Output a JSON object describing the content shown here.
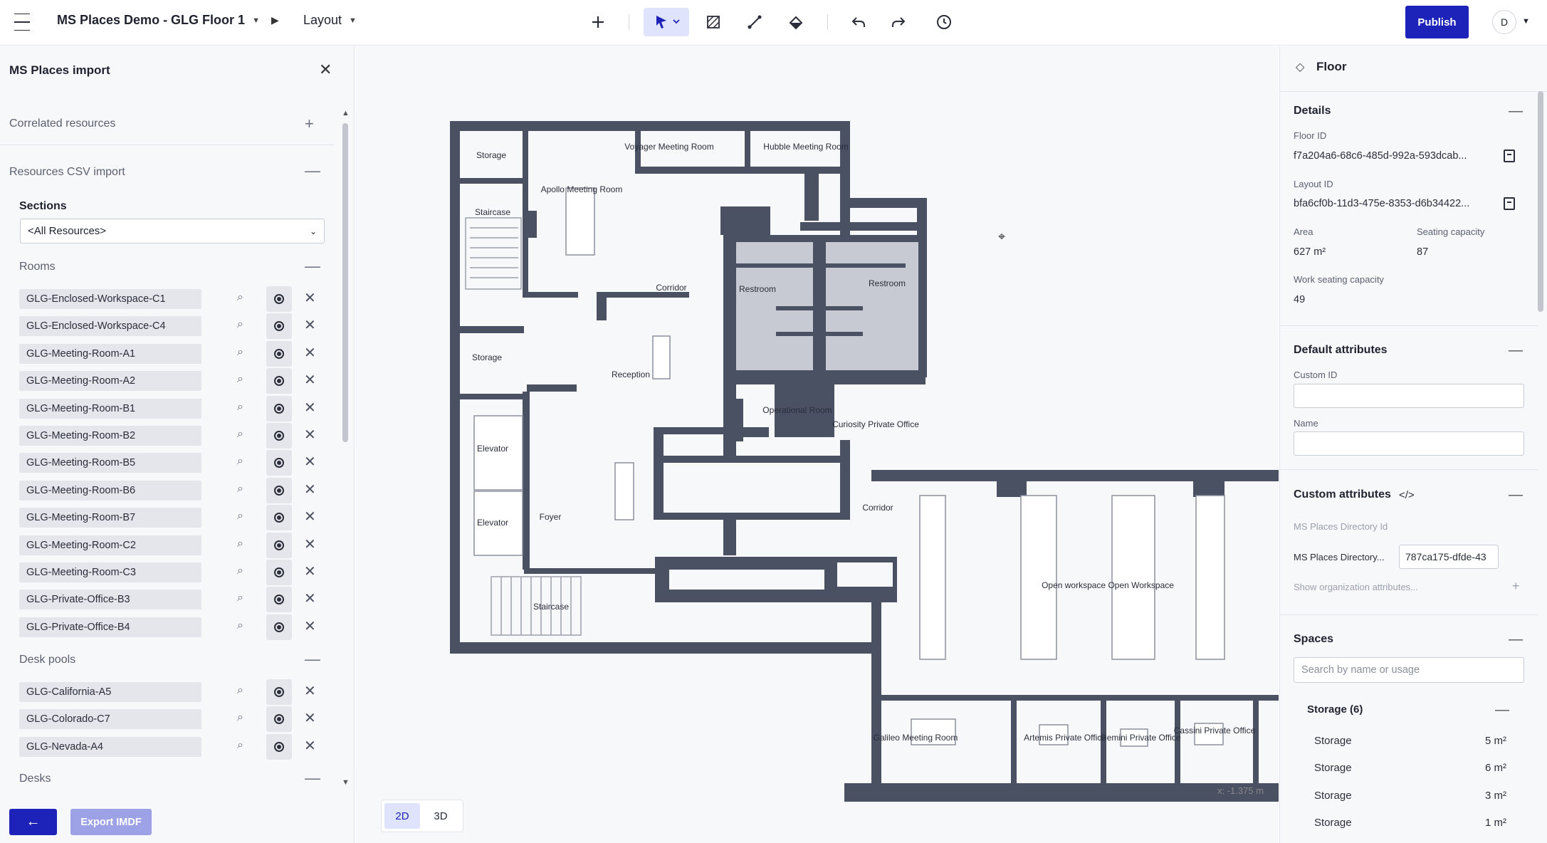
{
  "header": {
    "project_title": "MS Places Demo - GLG Floor 1",
    "view_label": "Layout",
    "publish_label": "Publish",
    "avatar_initial": "D"
  },
  "left_panel": {
    "title": "MS Places import",
    "correlated_label": "Correlated resources",
    "csv_import_label": "Resources CSV import",
    "sections_label": "Sections",
    "sections_selected": "<All Resources>",
    "rooms_label": "Rooms",
    "rooms": [
      "GLG-Enclosed-Workspace-C1",
      "GLG-Enclosed-Workspace-C4",
      "GLG-Meeting-Room-A1",
      "GLG-Meeting-Room-A2",
      "GLG-Meeting-Room-B1",
      "GLG-Meeting-Room-B2",
      "GLG-Meeting-Room-B5",
      "GLG-Meeting-Room-B6",
      "GLG-Meeting-Room-B7",
      "GLG-Meeting-Room-C2",
      "GLG-Meeting-Room-C3",
      "GLG-Private-Office-B3",
      "GLG-Private-Office-B4"
    ],
    "desk_pools_label": "Desk pools",
    "desk_pools": [
      "GLG-California-A5",
      "GLG-Colorado-C7",
      "GLG-Nevada-A4"
    ],
    "desks_label": "Desks",
    "back_label": "←",
    "export_label": "Export IMDF"
  },
  "canvas": {
    "view_2d": "2D",
    "view_3d": "3D",
    "coord_readout": "x: -1.375 m",
    "room_labels": {
      "storage": "Storage",
      "staircase": "Staircase",
      "apollo": "Apollo Meeting Room",
      "voyager": "Voyager Meeting Room",
      "hubble": "Hubble Meeting Room",
      "corridor": "Corridor",
      "restroom": "Restroom",
      "reception": "Reception",
      "elevator": "Elevator",
      "foyer": "Foyer",
      "operational": "Operational Room",
      "curiosity": "Curiosity Private Office",
      "open_workspace": "Open workspace Open Workspace",
      "galileo": "Galileo Meeting Room",
      "artemis": "Artemis Private Office",
      "gemini": "Gemini Private Office",
      "cassini": "Cassini Private Office"
    }
  },
  "right_panel": {
    "title": "Floor",
    "details_label": "Details",
    "floor_id_label": "Floor ID",
    "floor_id_value": "f7a204a6-68c6-485d-992a-593dcab...",
    "layout_id_label": "Layout ID",
    "layout_id_value": "bfa6cf0b-11d3-475e-8353-d6b34422...",
    "area_label": "Area",
    "area_value": "627 m²",
    "seating_label": "Seating capacity",
    "seating_value": "87",
    "work_seating_label": "Work seating capacity",
    "work_seating_value": "49",
    "default_attrs_label": "Default attributes",
    "custom_id_label": "Custom ID",
    "name_label": "Name",
    "custom_attrs_label": "Custom attributes",
    "custom_attrs_code_icon": "</>",
    "ms_dir_id_label": "MS Places Directory Id",
    "ms_dir_label": "MS Places Directory...",
    "ms_dir_value": "787ca175-dfde-43",
    "show_org_attrs": "Show organization attributes...",
    "spaces_label": "Spaces",
    "spaces_search_placeholder": "Search by name or usage",
    "storage_group_label": "Storage (6)",
    "storage_items": [
      {
        "name": "Storage",
        "area": "5 m²"
      },
      {
        "name": "Storage",
        "area": "6 m²"
      },
      {
        "name": "Storage",
        "area": "3 m²"
      },
      {
        "name": "Storage",
        "area": "1 m²"
      }
    ]
  },
  "colors": {
    "accent": "#1d23b8",
    "wall": "#4a5163",
    "panel_bg": "#f7f8fa"
  }
}
